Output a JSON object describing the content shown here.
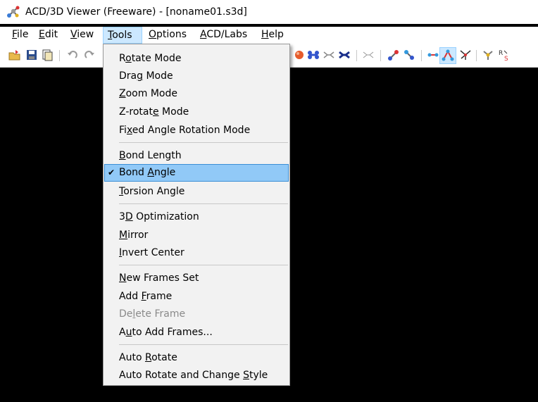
{
  "window": {
    "title": "ACD/3D Viewer (Freeware) - [noname01.s3d]",
    "icon": "molecule-app-icon"
  },
  "menubar": [
    {
      "id": "file",
      "before": "",
      "key": "F",
      "after": "ile"
    },
    {
      "id": "edit",
      "before": "",
      "key": "E",
      "after": "dit"
    },
    {
      "id": "view",
      "before": "",
      "key": "V",
      "after": "iew"
    },
    {
      "id": "tools",
      "before": "",
      "key": "T",
      "after": "ools",
      "active": true
    },
    {
      "id": "options",
      "before": "",
      "key": "O",
      "after": "ptions"
    },
    {
      "id": "acdlabs",
      "before": "",
      "key": "A",
      "after": "CD/Labs"
    },
    {
      "id": "help",
      "before": "",
      "key": "H",
      "after": "elp"
    }
  ],
  "toolbar": {
    "icons": [
      "open-icon",
      "save-icon",
      "copy-icon",
      "undo-icon",
      "redo-icon",
      "style-icon",
      "ball-stick-icon",
      "wireframe-icon",
      "spacefill-icon",
      "stick-icon",
      "atom-labels-icon",
      "hydrogen-icon",
      "bond-length-icon",
      "bond-angle-icon",
      "torsion-icon",
      "optimize-icon",
      "rs-label-icon"
    ]
  },
  "tools_menu": [
    {
      "id": "rotate-mode",
      "before": "R",
      "key": "o",
      "after": "tate Mode"
    },
    {
      "id": "drag-mode",
      "before": "Dra",
      "key": "g",
      "after": " Mode"
    },
    {
      "id": "zoom-mode",
      "before": "",
      "key": "Z",
      "after": "oom Mode"
    },
    {
      "id": "z-rotate-mode",
      "before": "Z-rotat",
      "key": "e",
      "after": " Mode"
    },
    {
      "id": "fixed-angle-rotation-mode",
      "before": "Fi",
      "key": "x",
      "after": "ed Angle Rotation Mode"
    },
    {
      "sep": true
    },
    {
      "id": "bond-length",
      "before": "",
      "key": "B",
      "after": "ond Length"
    },
    {
      "id": "bond-angle",
      "before": "Bond ",
      "key": "A",
      "after": "ngle",
      "checked": true,
      "selected": true
    },
    {
      "id": "torsion-angle",
      "before": "",
      "key": "T",
      "after": "orsion Angle"
    },
    {
      "sep": true
    },
    {
      "id": "3d-optimization",
      "before": "3",
      "key": "D",
      "after": " Optimization"
    },
    {
      "id": "mirror",
      "before": "",
      "key": "M",
      "after": "irror"
    },
    {
      "id": "invert-center",
      "before": "",
      "key": "I",
      "after": "nvert Center"
    },
    {
      "sep": true
    },
    {
      "id": "new-frames-set",
      "before": "",
      "key": "N",
      "after": "ew Frames Set"
    },
    {
      "id": "add-frame",
      "before": "Add ",
      "key": "F",
      "after": "rame"
    },
    {
      "id": "delete-frame",
      "before": "De",
      "key": "l",
      "after": "ete Frame",
      "disabled": true
    },
    {
      "id": "auto-add-frames",
      "before": "A",
      "key": "u",
      "after": "to Add Frames..."
    },
    {
      "sep": true
    },
    {
      "id": "auto-rotate",
      "before": "Auto ",
      "key": "R",
      "after": "otate"
    },
    {
      "id": "auto-rotate-change-style",
      "before": "Auto Rotate and Change ",
      "key": "S",
      "after": "tyle"
    }
  ],
  "check_glyph": "✔"
}
